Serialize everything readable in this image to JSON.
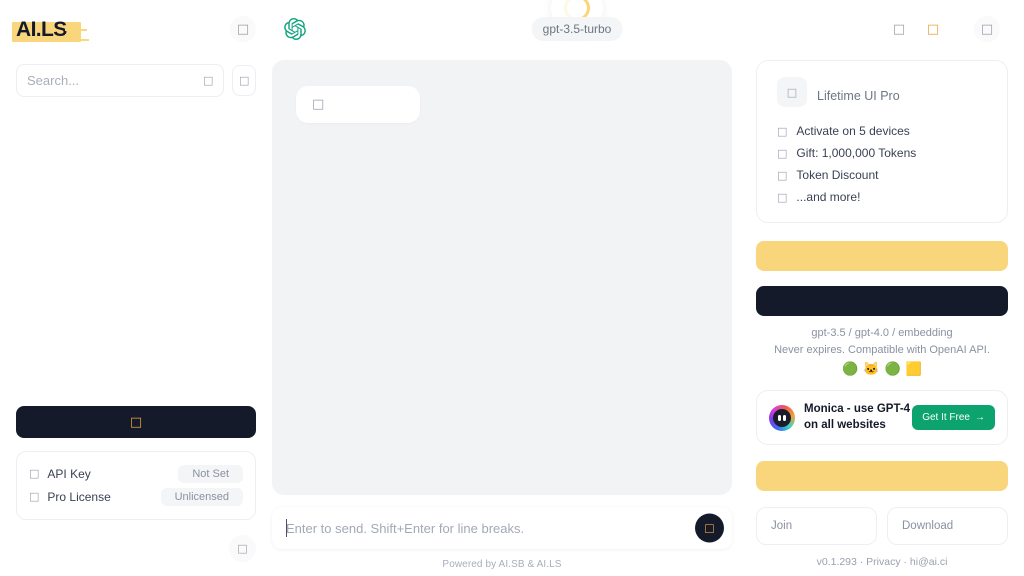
{
  "header": {
    "logo_text": "AI.LS",
    "sidebar_collapse_icon": "panel-collapse-icon",
    "openai_logo": "openai-logo",
    "model_pill": "gpt-3.5-turbo",
    "spinner": "loading-spinner",
    "action_icons": [
      "share-icon",
      "star-icon",
      "settings-icon"
    ]
  },
  "sidebar": {
    "search_placeholder": "Search...",
    "search_value": "",
    "search_inline_icon": "search-icon",
    "filter_icon": "filter-icon",
    "new_chat_icon": "plus-icon",
    "status": [
      {
        "icon": "key-icon",
        "label": "API Key",
        "badge": "Not Set"
      },
      {
        "icon": "license-icon",
        "label": "Pro License",
        "badge": "Unlicensed"
      }
    ],
    "footer_icon": "help-icon"
  },
  "chat": {
    "first_message_icon": "message-placeholder-icon",
    "input_placeholder": "Enter to send. Shift+Enter for line breaks.",
    "input_value": "",
    "send_icon": "send-icon",
    "powered_by": "Powered by AI.SB & AI.LS"
  },
  "right_panel": {
    "pro_card": {
      "badge_icon": "crown-icon",
      "title": "Lifetime UI Pro",
      "features": [
        {
          "icon": "check-icon",
          "text": "Activate on 5 devices"
        },
        {
          "icon": "gift-icon",
          "text": "Gift: 1,000,000 Tokens"
        },
        {
          "icon": "discount-icon",
          "text": "Token Discount"
        },
        {
          "icon": "sparkle-icon",
          "text": "...and more!"
        }
      ]
    },
    "primary_button_label": "",
    "secondary_button_label": "",
    "note_line_1": "gpt-3.5 / gpt-4.0 / embedding",
    "note_line_2": "Never expires. Compatible with OpenAI API.",
    "payment_emojis": [
      "🟢",
      "🐱",
      "🟢",
      "🟨"
    ],
    "monica_ad": {
      "avatar": "monica-avatar",
      "headline_line_1": "Monica - use GPT-4",
      "headline_line_2": "on all websites",
      "cta_label": "Get It Free",
      "cta_arrow": "arrow-right-icon"
    },
    "promo_button_label": "",
    "join_label": "Join",
    "download_label": "Download",
    "footer": "v0.1.293 · Privacy · hi@ai.ci"
  },
  "colors": {
    "accent_yellow": "#F9D57C",
    "dark": "#141A2A",
    "openai_green": "#10A37F",
    "monica_green": "#0DA36F",
    "chat_bg": "#F2F3F5"
  }
}
